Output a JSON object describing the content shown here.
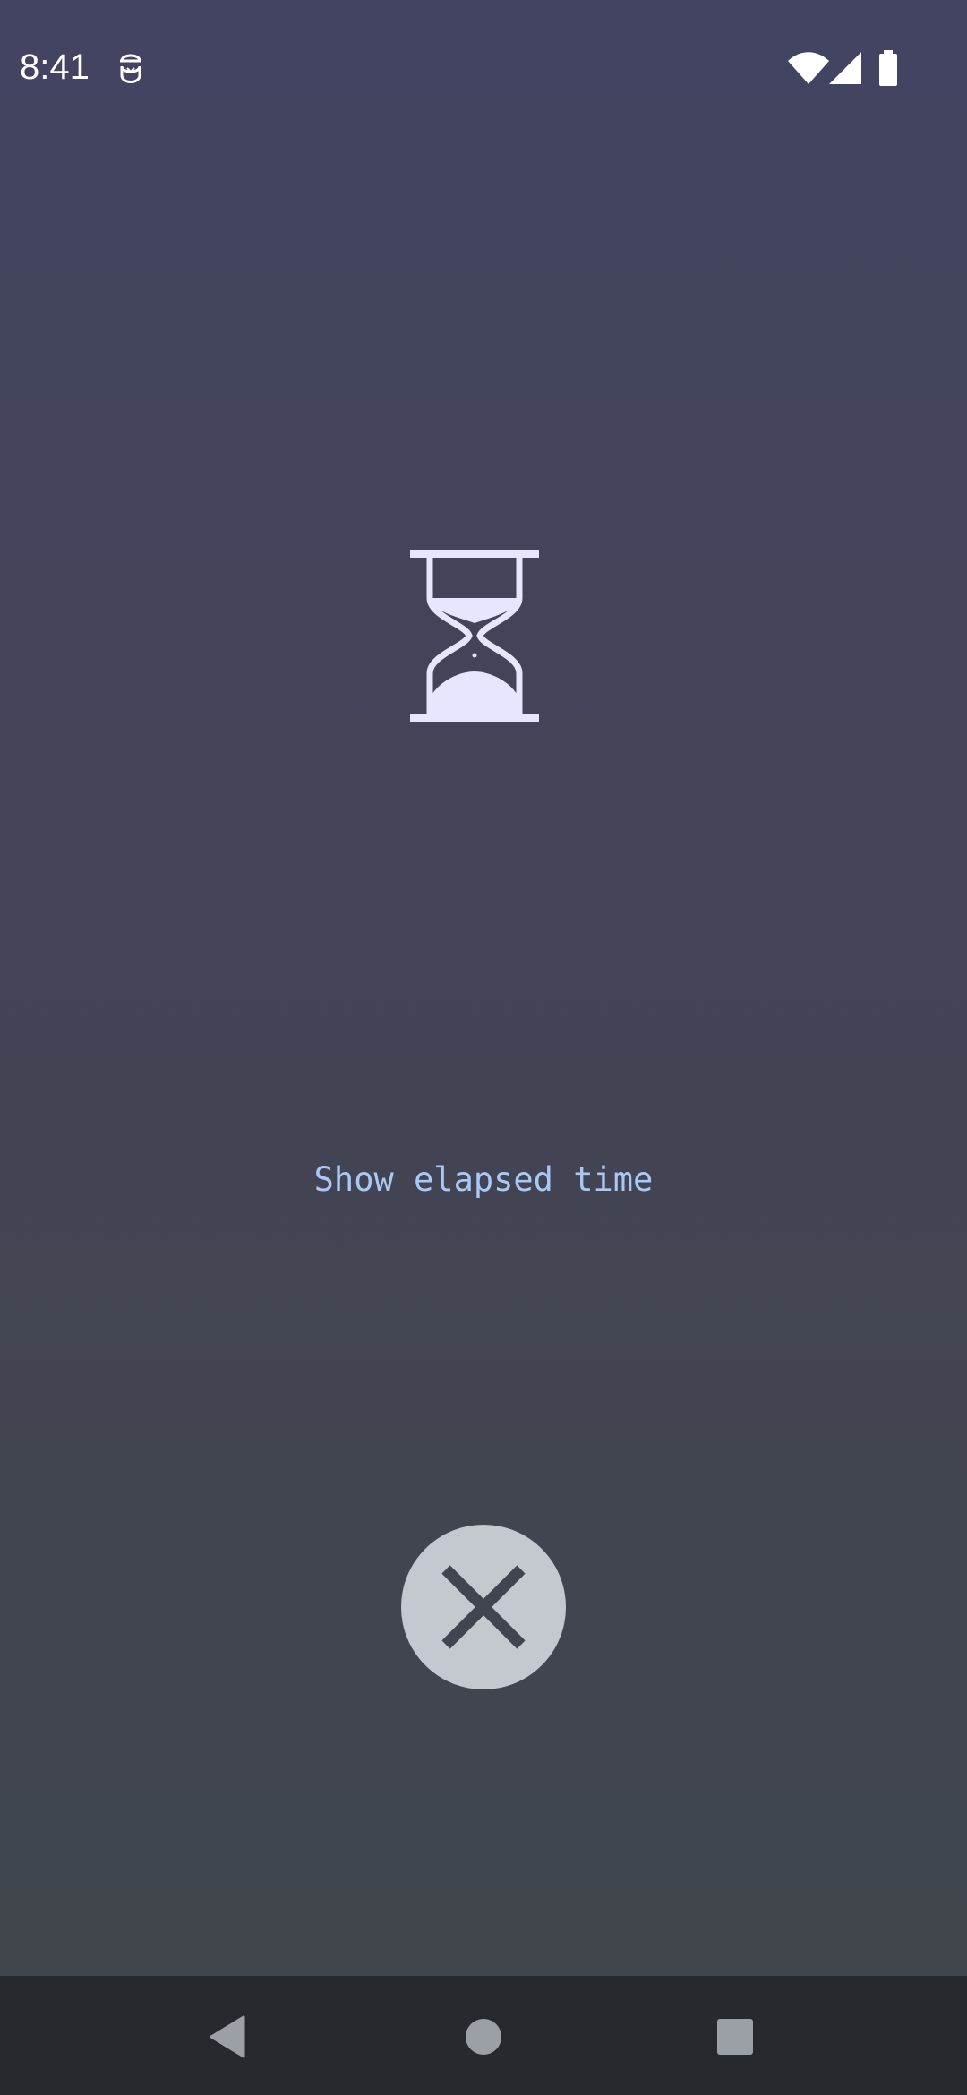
{
  "status_bar": {
    "time": "8:41",
    "app_icon": "tvtime-notification-icon",
    "wifi_icon": "wifi-icon",
    "signal_icon": "cell-signal-icon",
    "battery_icon": "battery-icon"
  },
  "main": {
    "hourglass_icon": "hourglass-icon",
    "elapsed_link_label": "Show elapsed time",
    "close_icon": "close-icon"
  },
  "nav_bar": {
    "back_icon": "back-triangle-icon",
    "home_icon": "home-circle-icon",
    "recents_icon": "recents-square-icon"
  },
  "colors": {
    "background_top": "#434462",
    "background_bottom": "#40464b",
    "link_text": "#a9c8f5",
    "hourglass": "#e6e6ff",
    "close_button_bg": "#c3c9cf",
    "close_x": "#41454f",
    "nav_bar_bg": "#262a2e",
    "nav_icons": "#9aa0a6"
  }
}
